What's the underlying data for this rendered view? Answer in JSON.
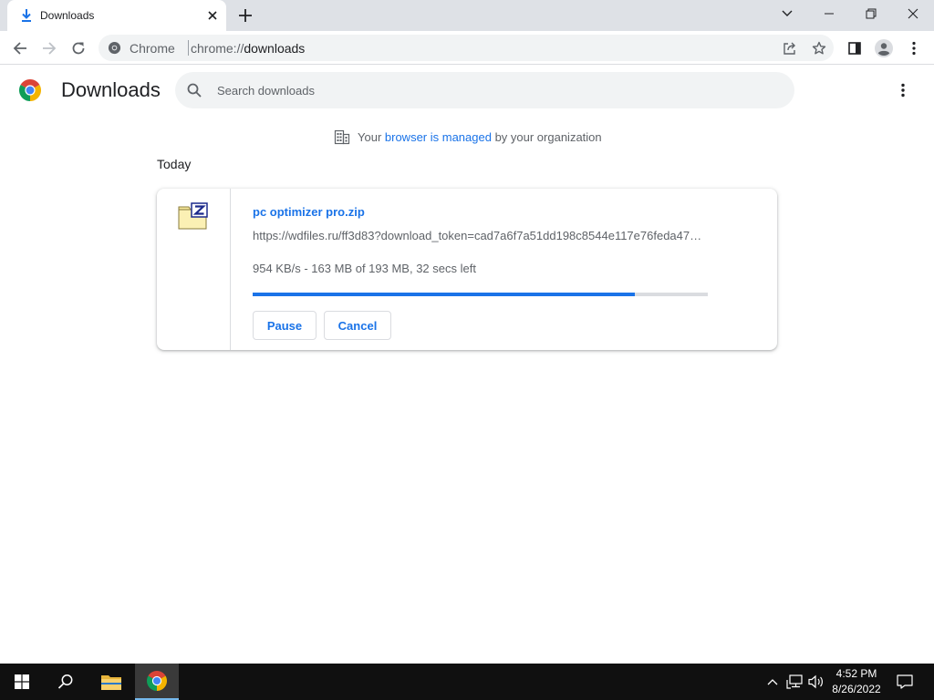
{
  "browser": {
    "tab": {
      "title": "Downloads",
      "icon": "download-icon",
      "close_icon": "close-icon"
    },
    "new_tab_icon": "plus-icon",
    "window_controls": [
      "chevron-down-icon",
      "minimize-icon",
      "restore-icon",
      "close-icon"
    ],
    "toolbar": {
      "nav_icons": [
        "back-arrow-icon",
        "forward-arrow-icon",
        "reload-icon"
      ],
      "omnibox": {
        "site_chip": "Chrome",
        "url_scheme": "chrome://",
        "url_rest": "downloads"
      },
      "omnibox_actions": [
        "share-icon",
        "star-icon"
      ],
      "right_icons": [
        "side-panel-icon",
        "profile-icon",
        "menu-kebab-icon"
      ]
    }
  },
  "page": {
    "title": "Downloads",
    "search_placeholder": "Search downloads",
    "managed_notice": {
      "prefix": "Your ",
      "link": "browser is managed",
      "suffix": " by your organization"
    },
    "date_header": "Today",
    "downloads": [
      {
        "file_name": "pc optimizer pro.zip",
        "url": "https://wdfiles.ru/ff3d83?download_token=cad7a6f7a51dd198c8544e117e76feda47…",
        "status": "954 KB/s - 163 MB of 193 MB, 32 secs left",
        "progress": 0.84,
        "pause_label": "Pause",
        "cancel_label": "Cancel"
      }
    ]
  },
  "taskbar": {
    "items": [
      "windows-start-icon",
      "search-icon",
      "file-explorer-icon",
      "chrome-icon"
    ],
    "tray_icons": [
      "chevron-up-icon",
      "network-icon",
      "volume-icon",
      "notification-icon"
    ],
    "time": "4:52 PM",
    "date": "8/26/2022"
  },
  "colors": {
    "accent": "#1a73e8",
    "tabstrip": "#dee1e6",
    "taskbar": "#101010"
  }
}
